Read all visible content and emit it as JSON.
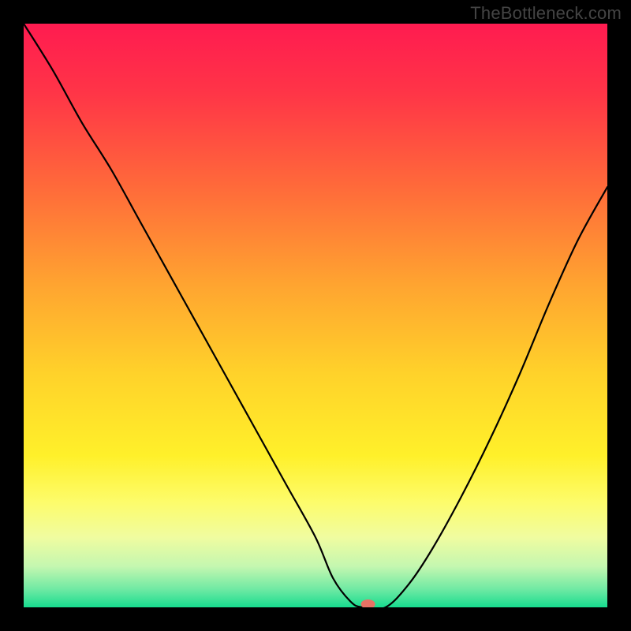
{
  "watermark": "TheBottleneck.com",
  "chart_data": {
    "type": "line",
    "title": "",
    "xlabel": "",
    "ylabel": "",
    "xlim": [
      0,
      100
    ],
    "ylim": [
      0,
      100
    ],
    "grid": false,
    "legend": false,
    "series": [
      {
        "name": "bottleneck-curve",
        "x": [
          0,
          5,
          10,
          15,
          20,
          25,
          30,
          35,
          40,
          45,
          50,
          53,
          56,
          58,
          62,
          66,
          70,
          75,
          80,
          85,
          90,
          95,
          100
        ],
        "y": [
          100,
          92,
          83,
          75,
          66,
          57,
          48,
          39,
          30,
          21,
          12,
          5,
          1,
          0,
          0,
          4,
          10,
          19,
          29,
          40,
          52,
          63,
          72
        ]
      }
    ],
    "marker": {
      "x": 59,
      "y": 0,
      "name": "optimal-point"
    },
    "background_gradient": {
      "stops": [
        {
          "offset": 0.0,
          "color": "#ff1b50"
        },
        {
          "offset": 0.12,
          "color": "#ff3547"
        },
        {
          "offset": 0.28,
          "color": "#ff6a3a"
        },
        {
          "offset": 0.45,
          "color": "#ffa530"
        },
        {
          "offset": 0.6,
          "color": "#ffd22a"
        },
        {
          "offset": 0.74,
          "color": "#fff02a"
        },
        {
          "offset": 0.82,
          "color": "#fdfc6b"
        },
        {
          "offset": 0.88,
          "color": "#f0fca0"
        },
        {
          "offset": 0.93,
          "color": "#c4f7b0"
        },
        {
          "offset": 0.97,
          "color": "#6de9a3"
        },
        {
          "offset": 1.0,
          "color": "#17dc8f"
        }
      ]
    }
  }
}
